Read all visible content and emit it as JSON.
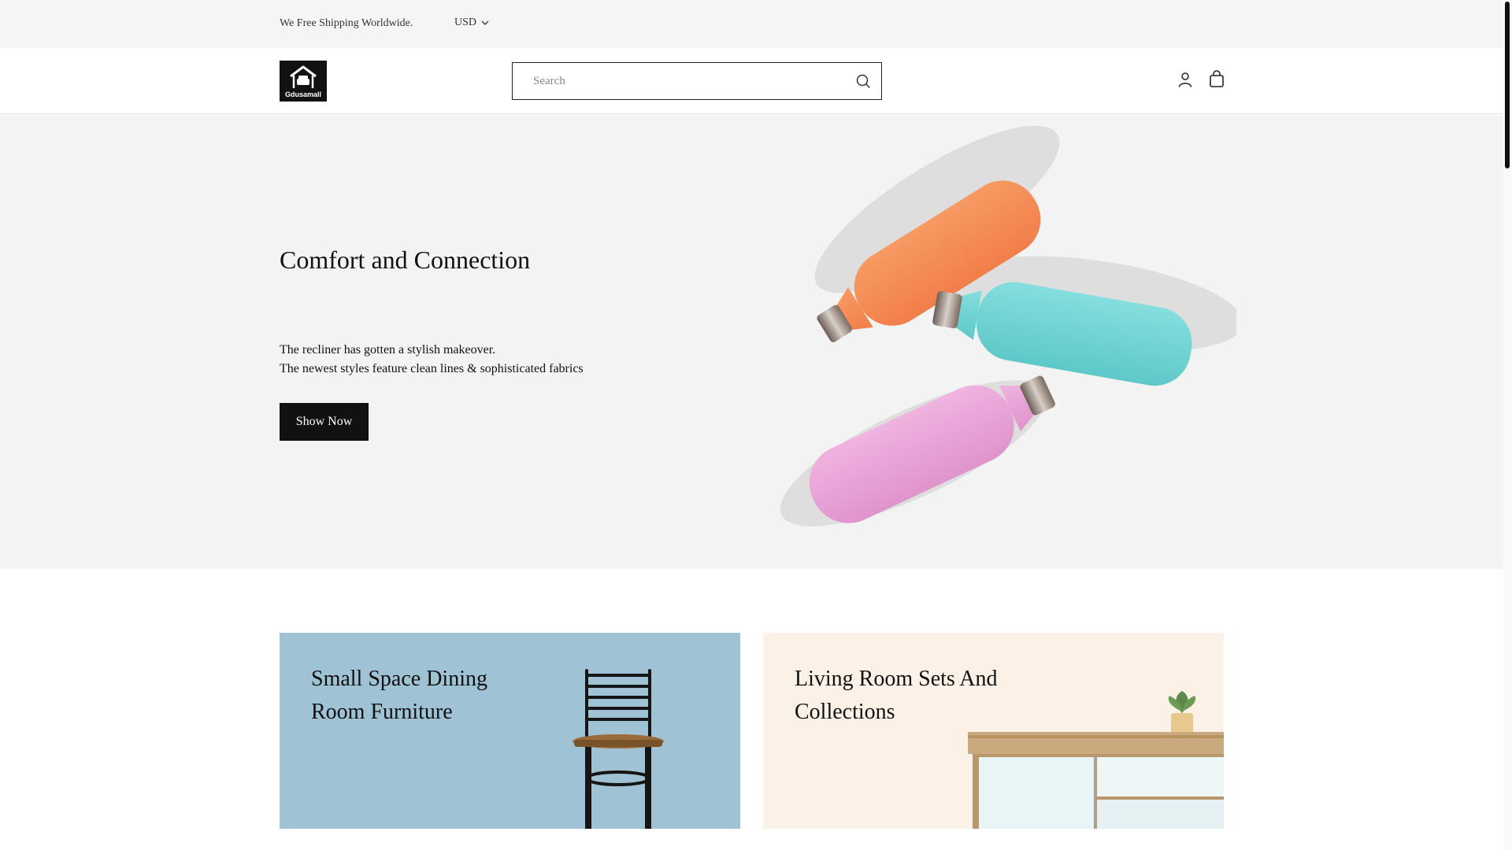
{
  "topbar": {
    "shipping_text": "We Free Shipping Worldwide.",
    "currency": "USD"
  },
  "header": {
    "logo_text": "Gdusamall",
    "search_placeholder": "Search"
  },
  "hero": {
    "title": "Comfort and Connection",
    "line1": "The recliner has gotten a stylish makeover.",
    "line2": "The newest styles feature clean lines & sophisticated fabrics",
    "cta_label": "Show Now"
  },
  "collections": [
    {
      "title": "Small Space Dining Room Furniture",
      "background": "#9fc3d5"
    },
    {
      "title": "Living Room Sets And Collections",
      "background": "#fbf1e6"
    }
  ],
  "colors": {
    "button": "#111111",
    "hero_background": "#f3f3f3",
    "bottle_orange": "#f58a55",
    "bottle_teal": "#6fd3d3",
    "bottle_pink": "#e9a3d6"
  },
  "icons": {
    "currency": "chevron-down-icon",
    "search": "search-icon",
    "account": "user-icon",
    "cart": "shopping-bag-icon"
  }
}
